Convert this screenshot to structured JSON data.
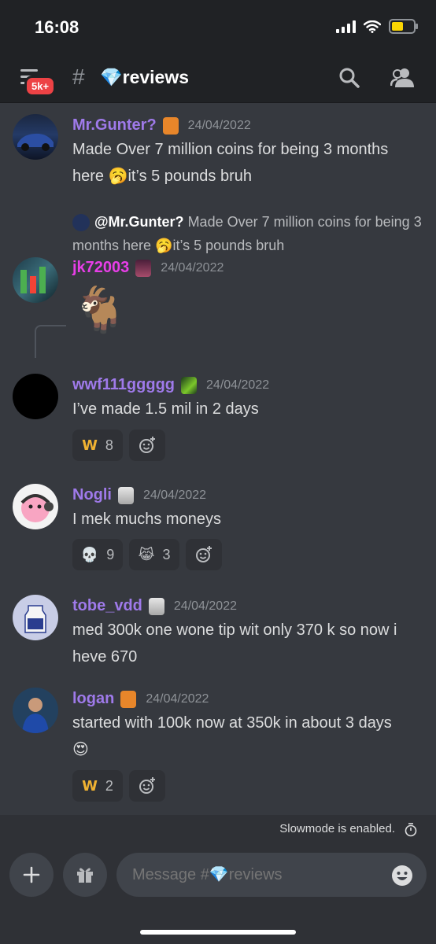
{
  "status_bar": {
    "time": "16:08"
  },
  "header": {
    "badge": "5k+",
    "hash": "#",
    "channel_name": "💎reviews"
  },
  "messages": [
    {
      "username": "Mr.Gunter?",
      "username_color": "#9f7aea",
      "timestamp": "24/04/2022",
      "text": "Made Over 7 million coins for being 3 months here 🥱it’s 5 pounds bruh"
    },
    {
      "reply_user": "@Mr.Gunter?",
      "reply_text": " Made Over 7 million coins for being 3 months here 🥱it’s 5 pounds bruh",
      "username": "jk72003",
      "username_color": "#e83ee8",
      "timestamp": "24/04/2022",
      "text": "🐐"
    },
    {
      "username": "wwf111ggggg",
      "username_color": "#9f7aea",
      "timestamp": "24/04/2022",
      "text": "I’ve made 1.5 mil in 2 days",
      "reactions": [
        {
          "emoji": "W",
          "count": "8"
        }
      ]
    },
    {
      "username": "Nogli",
      "username_color": "#9f7aea",
      "timestamp": "24/04/2022",
      "text": "I mek muchs moneys",
      "reactions": [
        {
          "emoji": "💀",
          "count": "9"
        },
        {
          "emoji": "😹",
          "count": "3"
        }
      ]
    },
    {
      "username": "tobe_vdd",
      "username_color": "#9f7aea",
      "timestamp": "24/04/2022",
      "text": "med 300k one wone tip wit only 370 k so now i heve 670"
    },
    {
      "username": "logan",
      "username_color": "#9f7aea",
      "timestamp": "24/04/2022",
      "text": "started with 100k now at 350k in about 3 days",
      "text2": "😍",
      "reactions": [
        {
          "emoji": "W",
          "count": "2"
        }
      ]
    }
  ],
  "slowmode": {
    "text": "Slowmode is enabled."
  },
  "composer": {
    "placeholder": "Message #💎reviews"
  },
  "colors": {
    "background": "#36393f",
    "header": "#202225",
    "composer": "#2f3136",
    "accent": "#ed4245"
  }
}
